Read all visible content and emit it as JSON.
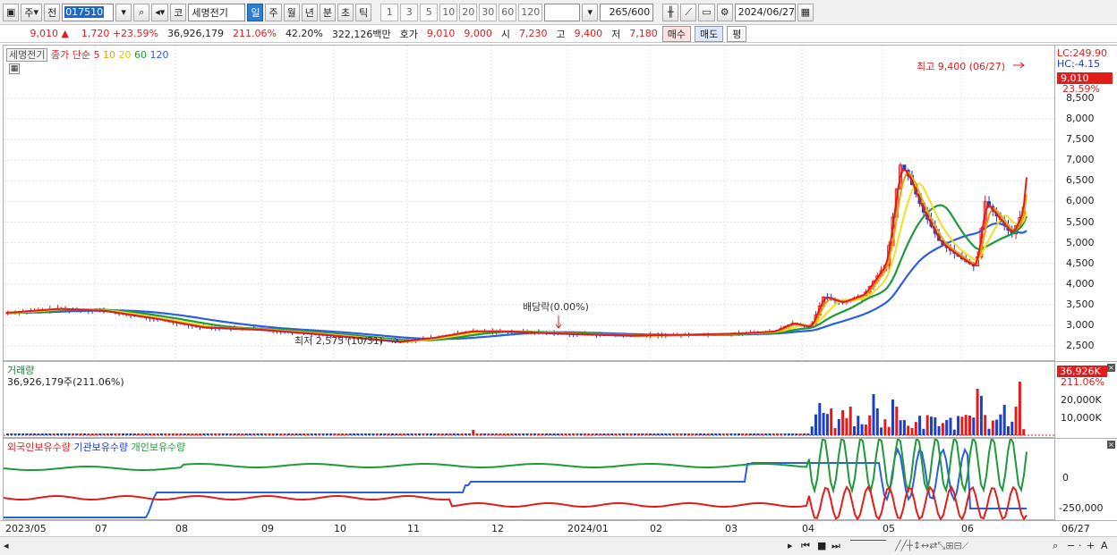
{
  "toolbar": {
    "type1": "주",
    "type2": "전",
    "code": "017510",
    "name": "세명전기",
    "market": "코",
    "periods": [
      "일",
      "주",
      "월",
      "년",
      "분",
      "초",
      "틱"
    ],
    "intervals": [
      "1",
      "3",
      "5",
      "10",
      "20",
      "30",
      "60",
      "120"
    ],
    "count": "265",
    "count_max": "/600",
    "date": "2024/06/27"
  },
  "quote": {
    "price": "9,010",
    "arrow": "▲",
    "change": "1,720",
    "pct": "+23.59%",
    "volume": "36,926,179",
    "vol_ratio": "211.06%",
    "turnover": "42.20%",
    "amount": "322,126백만",
    "hoga_label": "호가",
    "ask": "9,010",
    "bid": "9,000",
    "open_label": "시",
    "open": "7,230",
    "high_label": "고",
    "high": "9,400",
    "low_label": "저",
    "low": "7,180",
    "buy": "매수",
    "sell": "매도",
    "eval": "평"
  },
  "price_panel": {
    "name_tag": "세명전기",
    "legend_prefix": "종가 단순",
    "ma": [
      "5",
      "10",
      "20",
      "60",
      "120"
    ],
    "high_note": "최고 9,400 (06/27)",
    "low_note": "최저 2,575 (10/31)",
    "dividend": "배당락(0.00%)"
  },
  "price_axis": {
    "lc": "LC:249.90",
    "hc": "HC:-4.15",
    "last": "9,010",
    "last_pct": "23.59%",
    "ticks": [
      "8,500",
      "8,000",
      "7,500",
      "7,000",
      "6,500",
      "6,000",
      "5,500",
      "5,000",
      "4,500",
      "4,000",
      "3,500",
      "3,000",
      "2,500"
    ]
  },
  "volume_panel": {
    "title": "거래량",
    "info": "36,926,179주(211.06%)",
    "last": "36,926K",
    "last_pct": "211.06%",
    "ticks": [
      "20,000K",
      "10,000K"
    ]
  },
  "holding_panel": {
    "labels": [
      "외국인보유수량",
      "기관보유수량",
      "개인보유수량"
    ],
    "ticks": [
      "0",
      "-250,000"
    ]
  },
  "xaxis": {
    "labels": [
      "2023/05",
      "07",
      "08",
      "09",
      "10",
      "11",
      "12",
      "2024/01",
      "02",
      "03",
      "04",
      "05",
      "06"
    ],
    "right": "06/27"
  },
  "colors": {
    "up": "#e21b1b",
    "down": "#1a3fc9",
    "ma5": "#e21b1b",
    "ma10": "#f0a000",
    "ma20": "#f0e020",
    "ma60": "#1e9a3a",
    "ma120": "#2a5fe0"
  }
}
